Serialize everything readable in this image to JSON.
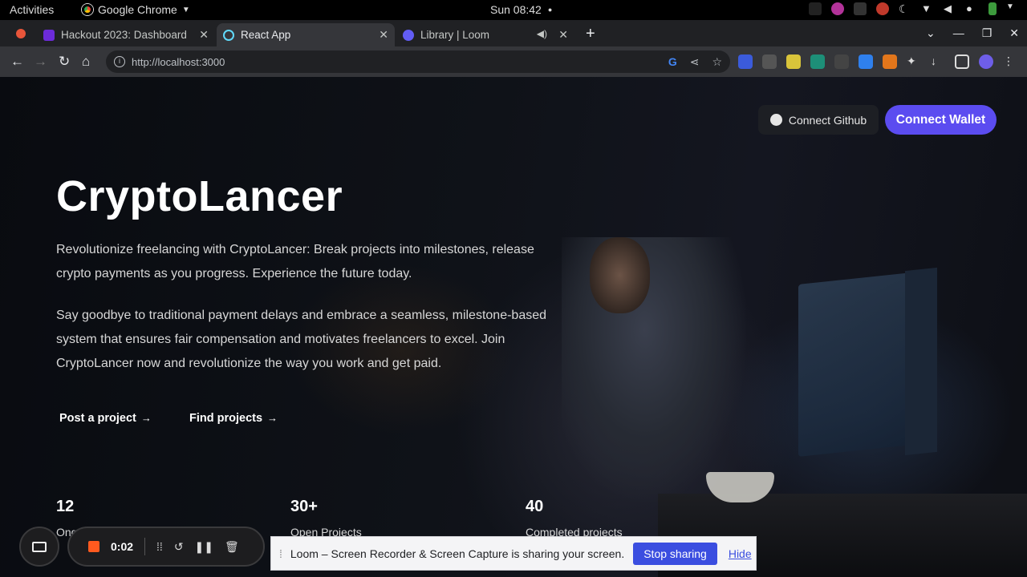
{
  "os_bar": {
    "activities": "Activities",
    "app_name": "Google Chrome",
    "clock": "Sun 08:42"
  },
  "tabs": [
    {
      "title": "Hackout 2023: Dashboard",
      "favicon_color": "#6c2bd9"
    },
    {
      "title": "React App",
      "favicon_color": "#61dafb",
      "active": true
    },
    {
      "title": "Library | Loom",
      "favicon_color": "#625df5"
    }
  ],
  "browser": {
    "url": "http://localhost:3000"
  },
  "header": {
    "github_label": "Connect Github",
    "wallet_label": "Connect Wallet"
  },
  "hero": {
    "title": "CryptoLancer",
    "paragraph1": "Revolutionize freelancing with CryptoLancer: Break projects into milestones, release crypto payments as you progress. Experience the future today.",
    "paragraph2": "Say goodbye to traditional payment delays and embrace a seamless, milestone-based system that ensures fair compensation and motivates freelancers to excel. Join CryptoLancer now and revolutionize the way you work and get paid.",
    "cta_post": "Post a project",
    "cta_find": "Find projects",
    "arrow": "→"
  },
  "stats": [
    {
      "value": "12",
      "label": "Ongoing Projects"
    },
    {
      "value": "30+",
      "label": "Open Projects"
    },
    {
      "value": "40",
      "label": "Completed projects"
    }
  ],
  "loom": {
    "timer": "0:02",
    "share_message": "Loom – Screen Recorder & Screen Capture is sharing your screen.",
    "stop_label": "Stop sharing",
    "hide_label": "Hide"
  },
  "colors": {
    "accent": "#5b4cf0",
    "loom_blue": "#3b4ee0",
    "record": "#ff5a1f"
  }
}
